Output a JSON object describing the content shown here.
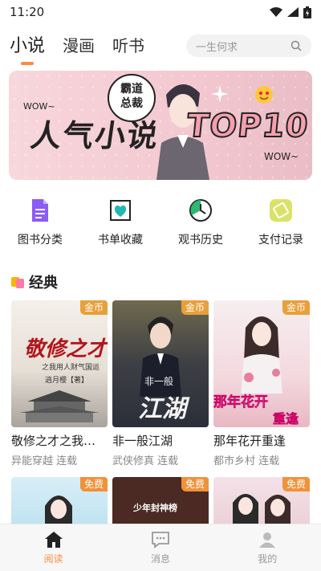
{
  "status": {
    "time": "11:20"
  },
  "nav": {
    "tabs": [
      {
        "label": "小说"
      },
      {
        "label": "漫画"
      },
      {
        "label": "听书"
      }
    ]
  },
  "search": {
    "placeholder": "一生何求"
  },
  "banner": {
    "title": "人气小说",
    "bubble_line1": "霸道",
    "bubble_line2": "总裁",
    "badge": "TOP10",
    "wow1": "WOW~",
    "wow2": "WOW~"
  },
  "quick": [
    {
      "label": "图书分类"
    },
    {
      "label": "书单收藏"
    },
    {
      "label": "观书历史"
    },
    {
      "label": "支付记录"
    }
  ],
  "section": {
    "title": "经典"
  },
  "books": [
    {
      "title": "敬修之才之我…",
      "meta": "异能穿越 连载",
      "badge": "金币",
      "cover_title": "敬修之才",
      "cover_sub": "之我用人财气国运",
      "cover_author": "逍月樱【著】"
    },
    {
      "title": "非一般江湖",
      "meta": "武侠修真 连载",
      "badge": "金币",
      "cover_title": "江湖",
      "cover_sub": "非一般"
    },
    {
      "title": "那年花开重逢",
      "meta": "都市乡村 连载",
      "badge": "金币",
      "cover_title": "那年花开",
      "cover_sub": "重逢"
    }
  ],
  "books_row2": [
    {
      "badge": "免费"
    },
    {
      "badge": "免费",
      "cover_title": "少年封神榜"
    },
    {
      "badge": "免费"
    }
  ],
  "tabbar": [
    {
      "label": "阅读"
    },
    {
      "label": "消息"
    },
    {
      "label": "我的"
    }
  ],
  "colors": {
    "accent": "#ff8a3d",
    "badge_gold": "#e8a03a",
    "badge_free": "#f0923a"
  }
}
